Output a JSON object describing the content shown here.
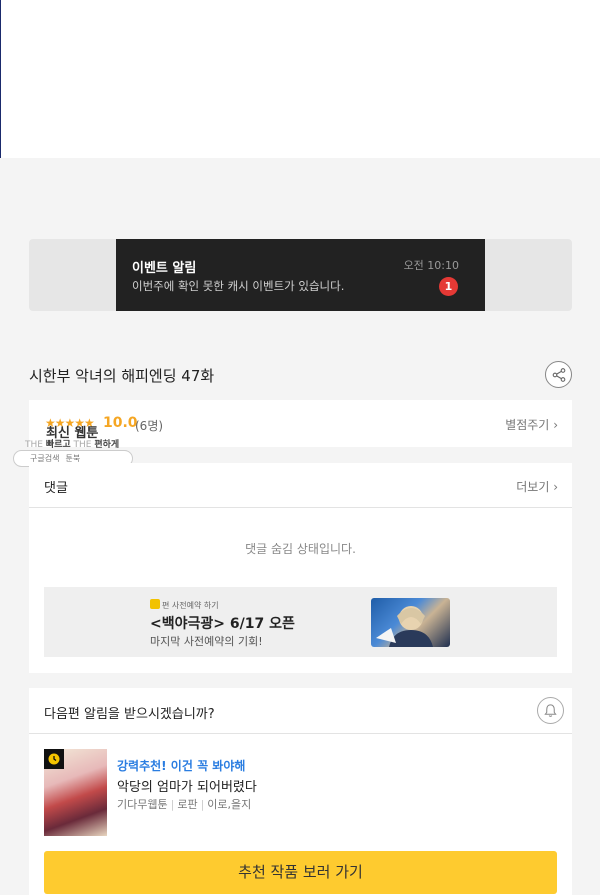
{
  "banner": {
    "title": "이벤트 알림",
    "message": "이번주에 확인 못한 캐시 이벤트가 있습니다.",
    "time": "오전 10:10",
    "badge": "1"
  },
  "episode": {
    "title": "시한부 악녀의 해피엔딩 47화"
  },
  "rating": {
    "stars": "★★★★★",
    "score": "10.0",
    "count": "(6명)",
    "rate_label": "별점주기",
    "overlay_title": "최신 웹툰",
    "overlay_sub_a": "THE",
    "overlay_sub_b": "빠르고",
    "overlay_sub_c": "THE",
    "overlay_sub_d": "편하게",
    "pill_a": "구글검색",
    "pill_b": "툰북"
  },
  "comments": {
    "title": "댓글",
    "more_label": "더보기",
    "hidden_message": "댓글 숨김 상태입니다.",
    "ad": {
      "small": "편 사전예약 하기",
      "main": "<백야극광> 6/17 오픈",
      "desc": "마지막 사전예약의 기회!"
    }
  },
  "notify": {
    "question": "다음편 알림을 받으시겠습니까?",
    "rec_tag": "강력추천! 이건 꼭 봐야해",
    "rec_title": "악당의 엄마가 되어버렸다",
    "rec_meta": [
      "기다무웹툰",
      "로판",
      "이로,을지"
    ],
    "cta": "추천 작품 보러 가기"
  },
  "colors": {
    "accent_yellow": "#fecb2f",
    "star_orange": "#f5a623",
    "badge_red": "#e53935",
    "tag_blue": "#2a7de1"
  }
}
